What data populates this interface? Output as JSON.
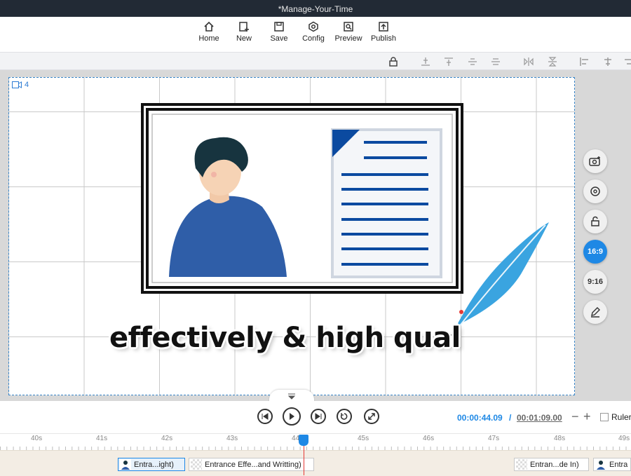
{
  "window": {
    "title": "*Manage-Your-Time"
  },
  "toolbar": {
    "items": [
      {
        "label": "Home",
        "icon": "home-icon"
      },
      {
        "label": "New",
        "icon": "new-icon"
      },
      {
        "label": "Save",
        "icon": "save-icon"
      },
      {
        "label": "Config",
        "icon": "config-icon"
      },
      {
        "label": "Preview",
        "icon": "preview-icon"
      },
      {
        "label": "Publish",
        "icon": "publish-icon"
      }
    ]
  },
  "canvas": {
    "scene_number": "4",
    "headline": "effectively & high qual"
  },
  "side_controls": {
    "ratio_16_9": "16:9",
    "ratio_9_16": "9:16"
  },
  "playback": {
    "current_time": "00:00:44.09",
    "separator": "/",
    "total_time": "00:01:09.00",
    "zoom_out": "−",
    "zoom_in": "+",
    "ruler_label": "Ruler"
  },
  "timeline": {
    "ticks": [
      "40s",
      "41s",
      "42s",
      "43s",
      "44s",
      "45s",
      "46s",
      "47s",
      "48s",
      "49s"
    ],
    "clips": [
      {
        "label": "Entra...ight)"
      },
      {
        "label": "Entrance Effe...and Writting)"
      },
      {
        "label": "Entran...de In)"
      },
      {
        "label": "Entra"
      }
    ]
  },
  "colors": {
    "accent": "#1e88e5",
    "titlebar": "#222a35",
    "playhead": "#e53935"
  }
}
